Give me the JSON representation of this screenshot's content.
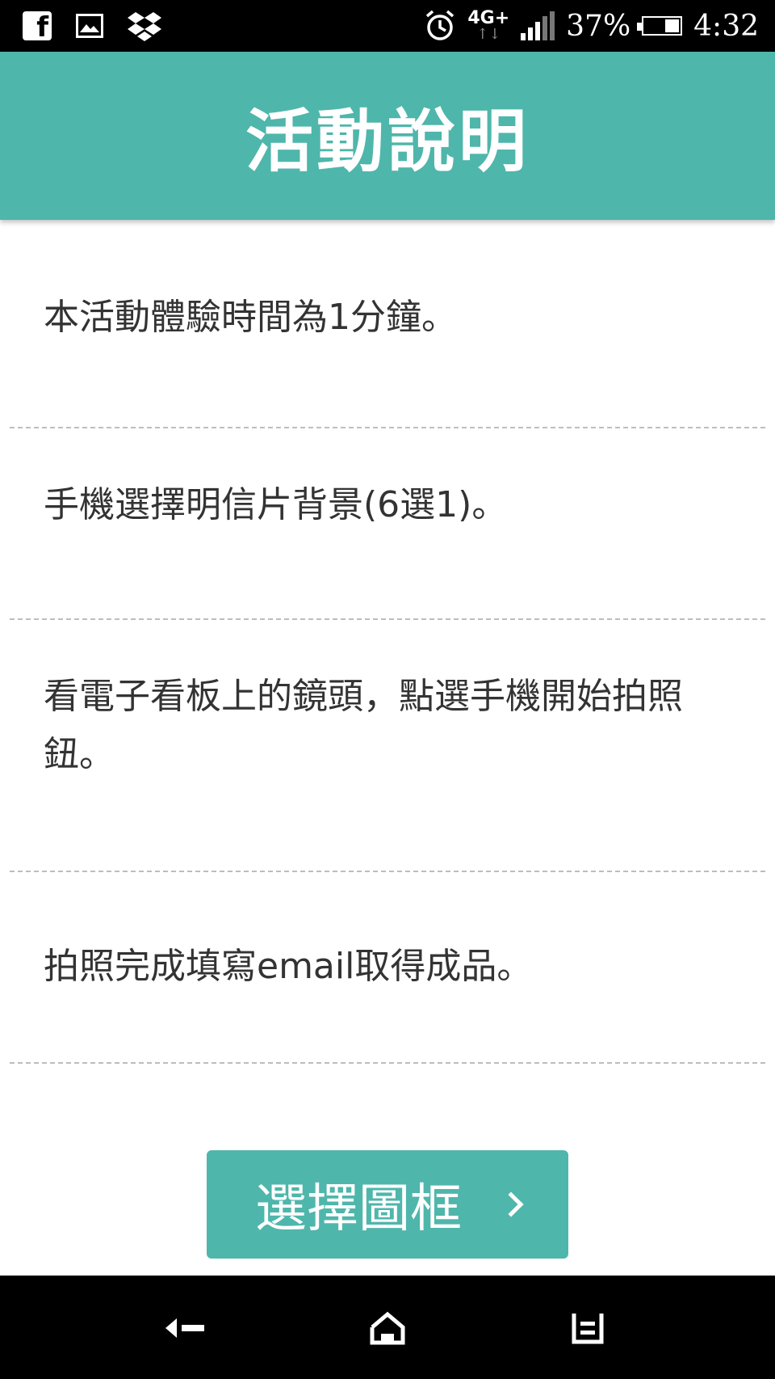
{
  "status_bar": {
    "battery_percent": "37%",
    "battery_level": 0.37,
    "time": "4:32",
    "network": "4G+",
    "icons": [
      "facebook-icon",
      "image-icon",
      "dropbox-icon",
      "alarm-icon",
      "signal-icon",
      "battery-icon"
    ]
  },
  "header": {
    "title": "活動說明"
  },
  "items": [
    {
      "text": "本活動體驗時間為1分鐘。"
    },
    {
      "text": "手機選擇明信片背景(6選1)。"
    },
    {
      "text": "看電子看板上的鏡頭，點選手機開始拍照鈕。"
    },
    {
      "text": "拍照完成填寫email取得成品。"
    }
  ],
  "button": {
    "label": "選擇圖框",
    "icon": "chevron-right-icon"
  },
  "nav_bar": {
    "icons": [
      "back-icon",
      "home-icon",
      "recent-apps-icon"
    ]
  },
  "colors": {
    "accent": "#4fb6ab",
    "text": "#333333",
    "divider": "#bdbdbd"
  }
}
